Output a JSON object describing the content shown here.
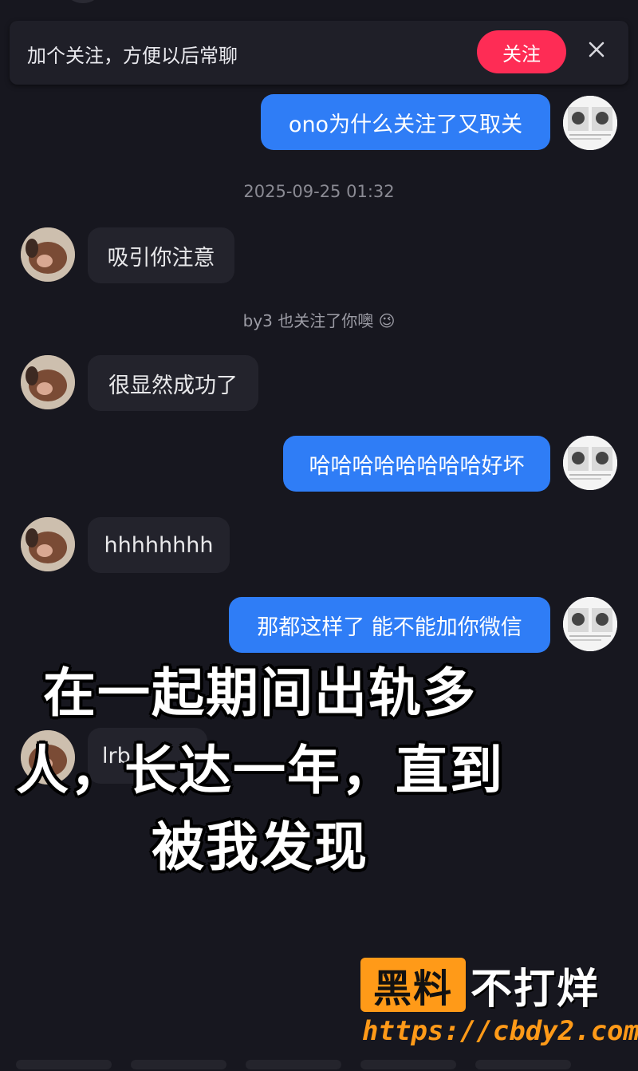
{
  "follow_banner": {
    "prompt": "加个关注，方便以后常聊",
    "follow_label": "关注"
  },
  "messages": [
    {
      "from": "me",
      "text": "ono为什么关注了又取关"
    },
    {
      "timestamp": "2025-09-25 01:32"
    },
    {
      "from": "them",
      "text": "吸引你注意"
    },
    {
      "system": "by3 也关注了你噢",
      "system_emoji": "😉"
    },
    {
      "from": "them",
      "text": "很显然成功了"
    },
    {
      "from": "me",
      "text": "哈哈哈哈哈哈哈哈好坏"
    },
    {
      "from": "them",
      "text": "hhhhhhhh"
    },
    {
      "from": "me",
      "text": "那都这样了 能不能加你微信"
    },
    {
      "from": "them",
      "text": "lrb"
    }
  ],
  "overlay": {
    "line1": "在一起期间出轨多",
    "line2": "人，长达一年，直到",
    "line3": "被我发现"
  },
  "watermark": {
    "brand_box": "黑料",
    "brand_text": "不打烊",
    "url": "https://cbdy2.com"
  },
  "colors": {
    "background": "#17171f",
    "my_bubble": "#2f7df6",
    "their_bubble": "#23232c",
    "follow_button": "#fe2c55",
    "watermark_accent": "#ff9a18"
  }
}
